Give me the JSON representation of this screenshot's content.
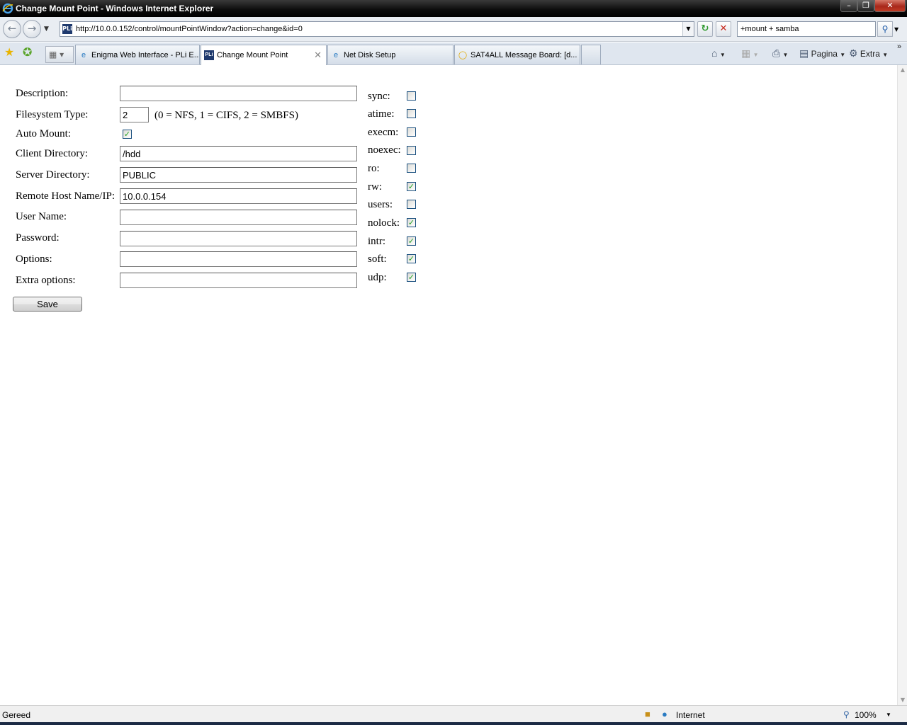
{
  "window": {
    "title": "Change Mount Point - Windows Internet Explorer"
  },
  "nav": {
    "url": "http://10.0.0.152/control/mountPointWindow?action=change&id=0",
    "search_value": "+mount + samba"
  },
  "tabs": [
    {
      "label": "Enigma Web Interface - PLi E...",
      "icon": "ie-page-icon"
    },
    {
      "label": "Change Mount Point",
      "icon": "pli-page-icon",
      "active": true
    },
    {
      "label": "Net Disk Setup",
      "icon": "ie-page-icon"
    },
    {
      "label": "SAT4ALL Message Board: [d...",
      "icon": "lightbulb-icon"
    }
  ],
  "commandbar": {
    "page_label": "Pagina",
    "extra_label": "Extra"
  },
  "form": {
    "description_label": "Description:",
    "description_value": "",
    "fstype_label": "Filesystem Type:",
    "fstype_value": "2",
    "fstype_hint": "(0 = NFS, 1 = CIFS, 2 = SMBFS)",
    "automount_label": "Auto Mount:",
    "automount_checked": true,
    "client_dir_label": "Client Directory:",
    "client_dir_value": "/hdd",
    "server_dir_label": "Server Directory:",
    "server_dir_value": "PUBLIC",
    "remote_host_label": "Remote Host Name/IP:",
    "remote_host_value": "10.0.0.154",
    "username_label": "User Name:",
    "username_value": "",
    "password_label": "Password:",
    "password_value": "",
    "options_label": "Options:",
    "options_value": "",
    "extra_options_label": "Extra options:",
    "extra_options_value": "",
    "save_label": "Save"
  },
  "mount_options": [
    {
      "label": "sync:",
      "checked": false
    },
    {
      "label": "atime:",
      "checked": false
    },
    {
      "label": "execm:",
      "checked": false
    },
    {
      "label": "noexec:",
      "checked": false
    },
    {
      "label": "ro:",
      "checked": false
    },
    {
      "label": "rw:",
      "checked": true
    },
    {
      "label": "users:",
      "checked": false
    },
    {
      "label": "nolock:",
      "checked": true
    },
    {
      "label": "intr:",
      "checked": true
    },
    {
      "label": "soft:",
      "checked": true
    },
    {
      "label": "udp:",
      "checked": true
    }
  ],
  "status": {
    "text": "Gereed",
    "zone": "Internet",
    "zoom": "100%"
  }
}
